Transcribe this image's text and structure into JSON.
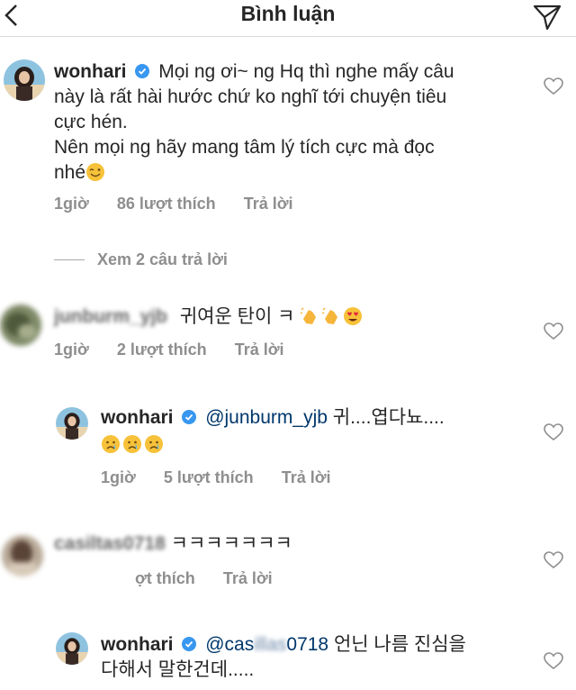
{
  "header": {
    "title": "Bình luận"
  },
  "comments": [
    {
      "user": "wonhari",
      "text": "Mọi ng ơi~ ng Hq thì nghe mấy câu này là rất hài hước chứ ko nghĩ tới chuyện tiêu cực hén.",
      "text_line1": "Mọi ng ơi~ ng Hq thì nghe mấy câu",
      "text_line2": "này là rất hài hước chứ ko nghĩ tới chuyện tiêu",
      "text_line3": "cực hén.",
      "text_line4": "Nên mọi ng hãy mang tâm lý tích cực mà đọc",
      "text_line5": "nhé",
      "time": "1giờ",
      "likes": "86 lượt thích",
      "reply": "Trả lời",
      "view_replies": "Xem 2 câu trả lời"
    },
    {
      "user": "junburm_yjb",
      "text": "귀여운 탄이 ㅋ",
      "time": "1giờ",
      "likes": "2 lượt thích",
      "reply": "Trả lời"
    },
    {
      "user": "wonhari",
      "mention": "@junburm_yjb",
      "text": "귀....엽다뇨....",
      "time": "1giờ",
      "likes": "5 lượt thích",
      "reply": "Trả lời"
    },
    {
      "user": "casiltas0718",
      "text_visible": "ㅋㅋㅋㅋㅋㅋㅋ",
      "likes_partial": "ợt thích",
      "reply": "Trả lời"
    },
    {
      "user": "wonhari",
      "mention_visible": "@cas",
      "mention_tail": "0718",
      "text": "언닌 나름 진심을",
      "text_line2": "다해서 말한건데....."
    }
  ],
  "icons": {
    "back": "chevron-left-icon",
    "send": "paper-plane-icon",
    "verified": "verified-badge-icon",
    "heart": "heart-outline-icon"
  },
  "colors": {
    "verified": "#3897f0",
    "meta": "#8e8e8e",
    "mention": "#00376b"
  }
}
